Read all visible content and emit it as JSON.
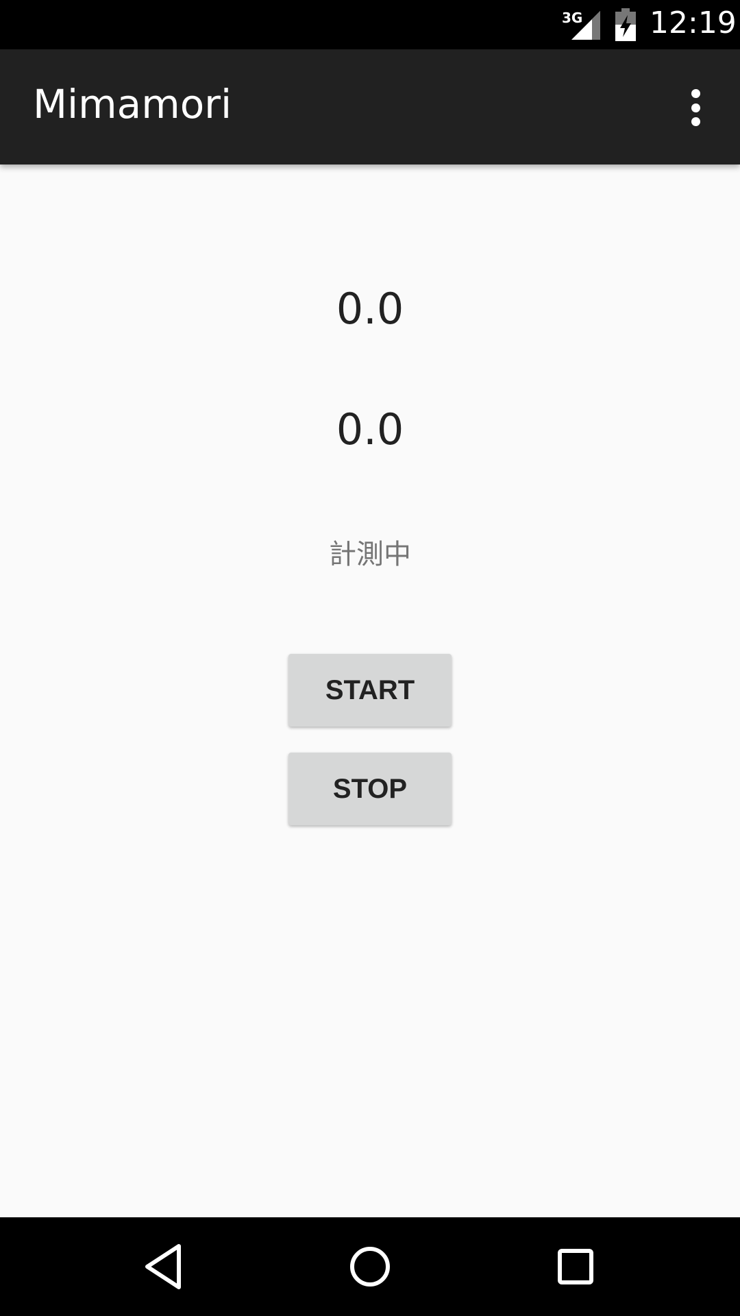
{
  "status_bar": {
    "network": "3G",
    "time": "12:19"
  },
  "app_bar": {
    "title": "Mimamori",
    "menu_icon": "more-vert-icon"
  },
  "main": {
    "value_1": "0.0",
    "value_2": "0.0",
    "status": "計測中",
    "start_label": "START",
    "stop_label": "STOP"
  },
  "nav_bar": {
    "icons": [
      "back-icon",
      "home-icon",
      "recents-icon"
    ]
  },
  "colors": {
    "status_bar": "#000000",
    "app_bar": "#212121",
    "background": "#fafafa",
    "button": "#d6d7d7"
  }
}
